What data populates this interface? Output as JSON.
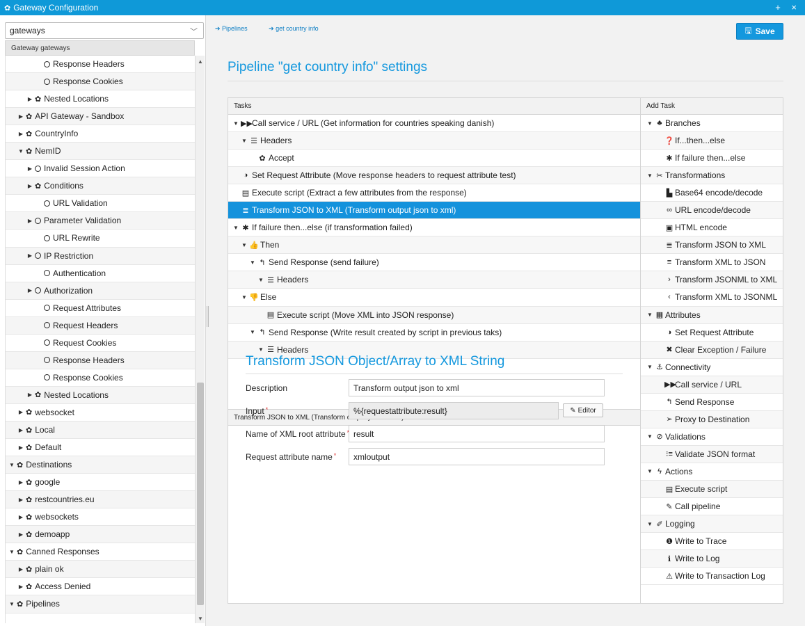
{
  "window": {
    "title": "Gateway Configuration",
    "controls": "+ ×"
  },
  "sidebar": {
    "select_value": "gateways",
    "tree_header": "Gateway gateways",
    "items": [
      {
        "label": "Response Headers",
        "indent": 3,
        "caret": "",
        "icon": "circle"
      },
      {
        "label": "Response Cookies",
        "indent": 3,
        "caret": "",
        "icon": "circle"
      },
      {
        "label": "Nested Locations",
        "indent": 2,
        "caret": "right",
        "icon": "gear"
      },
      {
        "label": "API Gateway - Sandbox",
        "indent": 1,
        "caret": "right",
        "icon": "gear"
      },
      {
        "label": "CountryInfo",
        "indent": 1,
        "caret": "right",
        "icon": "gear"
      },
      {
        "label": "NemID",
        "indent": 1,
        "caret": "down",
        "icon": "gear"
      },
      {
        "label": "Invalid Session Action",
        "indent": 2,
        "caret": "right",
        "icon": "circle"
      },
      {
        "label": "Conditions",
        "indent": 2,
        "caret": "right",
        "icon": "gear"
      },
      {
        "label": "URL Validation",
        "indent": 3,
        "caret": "",
        "icon": "circle"
      },
      {
        "label": "Parameter Validation",
        "indent": 2,
        "caret": "right",
        "icon": "circle"
      },
      {
        "label": "URL Rewrite",
        "indent": 3,
        "caret": "",
        "icon": "circle"
      },
      {
        "label": "IP Restriction",
        "indent": 2,
        "caret": "right",
        "icon": "circle"
      },
      {
        "label": "Authentication",
        "indent": 3,
        "caret": "",
        "icon": "circle"
      },
      {
        "label": "Authorization",
        "indent": 2,
        "caret": "right",
        "icon": "circle"
      },
      {
        "label": "Request Attributes",
        "indent": 3,
        "caret": "",
        "icon": "circle"
      },
      {
        "label": "Request Headers",
        "indent": 3,
        "caret": "",
        "icon": "circle"
      },
      {
        "label": "Request Cookies",
        "indent": 3,
        "caret": "",
        "icon": "circle"
      },
      {
        "label": "Response Headers",
        "indent": 3,
        "caret": "",
        "icon": "circle"
      },
      {
        "label": "Response Cookies",
        "indent": 3,
        "caret": "",
        "icon": "circle"
      },
      {
        "label": "Nested Locations",
        "indent": 2,
        "caret": "right",
        "icon": "gear"
      },
      {
        "label": "websocket",
        "indent": 1,
        "caret": "right",
        "icon": "gear"
      },
      {
        "label": "Local",
        "indent": 1,
        "caret": "right",
        "icon": "gear"
      },
      {
        "label": "Default",
        "indent": 1,
        "caret": "right",
        "icon": "gear"
      },
      {
        "label": "Destinations",
        "indent": 0,
        "caret": "down",
        "icon": "gear"
      },
      {
        "label": "google",
        "indent": 1,
        "caret": "right",
        "icon": "gear"
      },
      {
        "label": "restcountries.eu",
        "indent": 1,
        "caret": "right",
        "icon": "gear"
      },
      {
        "label": "websockets",
        "indent": 1,
        "caret": "right",
        "icon": "gear"
      },
      {
        "label": "demoapp",
        "indent": 1,
        "caret": "right",
        "icon": "gear"
      },
      {
        "label": "Canned Responses",
        "indent": 0,
        "caret": "down",
        "icon": "gear"
      },
      {
        "label": "plain ok",
        "indent": 1,
        "caret": "right",
        "icon": "gear"
      },
      {
        "label": "Access Denied",
        "indent": 1,
        "caret": "right",
        "icon": "gear"
      },
      {
        "label": "Pipelines",
        "indent": 0,
        "caret": "down",
        "icon": "gear"
      }
    ]
  },
  "breadcrumb": [
    "Pipelines",
    "get country info"
  ],
  "toolbar": {
    "save_label": "Save"
  },
  "page_title": "Pipeline \"get country info\" settings",
  "tasks": {
    "header": "Tasks",
    "rows": [
      {
        "label": "Call service / URL (Get information for countries speaking danish)",
        "indent": 0,
        "caret": "down",
        "icon": "▶▶",
        "selected": false
      },
      {
        "label": "Headers",
        "indent": 1,
        "caret": "down",
        "icon": "☰",
        "selected": false
      },
      {
        "label": "Accept",
        "indent": 2,
        "caret": "",
        "icon": "✿",
        "selected": false
      },
      {
        "label": "Set Request Attribute (Move response headers to request attribute test)",
        "indent": 0,
        "caret": "",
        "icon": "◑",
        "selected": false
      },
      {
        "label": "Execute script (Extract a few attributes from the response)",
        "indent": 0,
        "caret": "",
        "icon": "▤",
        "selected": false
      },
      {
        "label": "Transform JSON to XML (Transform output json to xml)",
        "indent": 0,
        "caret": "",
        "icon": "≣",
        "selected": true
      },
      {
        "label": "If failure then...else (if transformation failed)",
        "indent": 0,
        "caret": "down",
        "icon": "✱",
        "selected": false
      },
      {
        "label": "Then",
        "indent": 1,
        "caret": "down",
        "icon": "👍",
        "selected": false
      },
      {
        "label": "Send Response (send failure)",
        "indent": 2,
        "caret": "down",
        "icon": "↰",
        "selected": false
      },
      {
        "label": "Headers",
        "indent": 3,
        "caret": "down",
        "icon": "☰",
        "selected": false
      },
      {
        "label": "Else",
        "indent": 1,
        "caret": "down",
        "icon": "👎",
        "selected": false
      },
      {
        "label": "Execute script (Move XML into JSON response)",
        "indent": 3,
        "caret": "",
        "icon": "▤",
        "selected": false
      },
      {
        "label": "Send Response (Write result created by script in previous taks)",
        "indent": 2,
        "caret": "down",
        "icon": "↰",
        "selected": false
      },
      {
        "label": "Headers",
        "indent": 3,
        "caret": "down",
        "icon": "☰",
        "selected": false
      }
    ]
  },
  "details": {
    "header": "Transform JSON to XML (Transform output json to xml) details",
    "title": "Transform JSON Object/Array to XML String",
    "fields": {
      "description": {
        "label": "Description",
        "value": "Transform output json to xml",
        "required": ""
      },
      "input": {
        "label": "Input",
        "value": "%{requestattribute:result}",
        "required": "*"
      },
      "root": {
        "label": "Name of XML root attribute",
        "value": "result",
        "required": "*"
      },
      "reqattr": {
        "label": "Request attribute name",
        "value": "xmloutput",
        "required": "*"
      }
    },
    "editor_label": "Editor"
  },
  "add_task": {
    "header": "Add Task",
    "rows": [
      {
        "label": "Branches",
        "type": "cat",
        "icon": "♣"
      },
      {
        "label": "If...then...else",
        "type": "item",
        "icon": "❓"
      },
      {
        "label": "If failure then...else",
        "type": "item",
        "icon": "✱"
      },
      {
        "label": "Transformations",
        "type": "cat",
        "icon": "✂"
      },
      {
        "label": "Base64 encode/decode",
        "type": "item",
        "icon": "▙"
      },
      {
        "label": "URL encode/decode",
        "type": "item",
        "icon": "∞"
      },
      {
        "label": "HTML encode",
        "type": "item",
        "icon": "▣"
      },
      {
        "label": "Transform JSON to XML",
        "type": "item",
        "icon": "≣"
      },
      {
        "label": "Transform XML to JSON",
        "type": "item",
        "icon": "≡"
      },
      {
        "label": "Transform JSONML to XML",
        "type": "item",
        "icon": "›"
      },
      {
        "label": "Transform XML to JSONML",
        "type": "item",
        "icon": "‹"
      },
      {
        "label": "Attributes",
        "type": "cat",
        "icon": "▦"
      },
      {
        "label": "Set Request Attribute",
        "type": "item",
        "icon": "◑"
      },
      {
        "label": "Clear Exception / Failure",
        "type": "item",
        "icon": "✖"
      },
      {
        "label": "Connectivity",
        "type": "cat",
        "icon": "⚓"
      },
      {
        "label": "Call service / URL",
        "type": "item",
        "icon": "▶▶"
      },
      {
        "label": "Send Response",
        "type": "item",
        "icon": "↰"
      },
      {
        "label": "Proxy to Destination",
        "type": "item",
        "icon": "➢"
      },
      {
        "label": "Validations",
        "type": "cat",
        "icon": "⊘"
      },
      {
        "label": "Validate JSON format",
        "type": "item",
        "icon": "⁝≡"
      },
      {
        "label": "Actions",
        "type": "cat",
        "icon": "ϟ"
      },
      {
        "label": "Execute script",
        "type": "item",
        "icon": "▤"
      },
      {
        "label": "Call pipeline",
        "type": "item",
        "icon": "✎"
      },
      {
        "label": "Logging",
        "type": "cat",
        "icon": "✐"
      },
      {
        "label": "Write to Trace",
        "type": "item",
        "icon": "❶"
      },
      {
        "label": "Write to Log",
        "type": "item",
        "icon": "ℹ"
      },
      {
        "label": "Write to Transaction Log",
        "type": "item",
        "icon": "⚠"
      }
    ]
  }
}
